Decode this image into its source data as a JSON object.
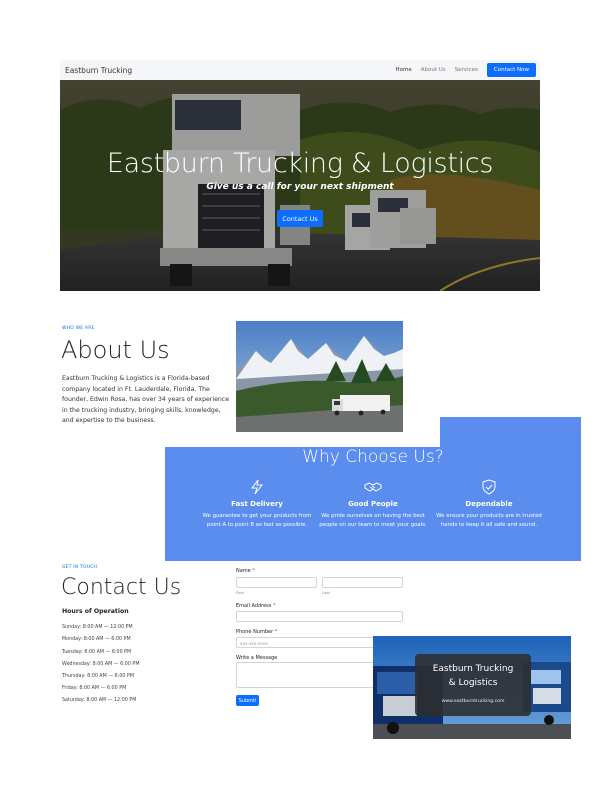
{
  "nav": {
    "brand": "Eastburn Trucking",
    "links": [
      "Home",
      "About Us",
      "Services"
    ],
    "cta": "Contact Now"
  },
  "hero": {
    "title": "Eastburn Trucking & Logistics",
    "subtitle": "Give us a call for your next shipment",
    "button": "Contact Us"
  },
  "about": {
    "eyebrow": "WHO WE ARE",
    "title": "About Us",
    "text": "Eastburn Trucking & Logistics is a Florida-based company located in Ft. Lauderdale, Florida. The founder, Edwin Rosa, has over 34 years of experience in the trucking industry, bringing skills, knowledge, and expertise to the business."
  },
  "why": {
    "title": "Why Choose Us?",
    "features": [
      {
        "icon": "lightning-icon",
        "title": "Fast Delivery",
        "desc": "We guarantee to get your products from point A to point B as fast as possible."
      },
      {
        "icon": "handshake-icon",
        "title": "Good People",
        "desc": "We pride ourselves on having the best people on our team to meet your goals."
      },
      {
        "icon": "shield-check-icon",
        "title": "Dependable",
        "desc": "We ensure your products are in trusted hands to keep it all safe and sound."
      }
    ]
  },
  "contact": {
    "eyebrow": "GET IN TOUCH",
    "title": "Contact Us",
    "hours_title": "Hours of Operation",
    "hours": [
      "Sunday: 8:00 AM — 12:00 PM",
      "Monday: 8:00 AM — 6:00 PM",
      "Tuesday: 8:00 AM — 6:00 PM",
      "Wednesday: 8:00 AM — 6:00 PM",
      "Thursday: 8:00 AM — 6:00 PM",
      "Friday: 8:00 AM — 6:00 PM",
      "Saturday: 8:00 AM — 12:00 PM"
    ]
  },
  "form": {
    "name_label": "Name",
    "first_label": "First",
    "last_label": "Last",
    "email_label": "Email Address",
    "phone_label": "Phone Number",
    "phone_placeholder": "xxx-xxx-xxxx",
    "message_label": "Write a Message",
    "required_mark": "*",
    "submit": "Submit"
  },
  "card": {
    "title_line1": "Eastburn Trucking",
    "title_line2": "& Logistics",
    "url": "www.eastburntrucking.com"
  },
  "colors": {
    "accent": "#0d6efd",
    "why_bg": "#5b8def"
  }
}
